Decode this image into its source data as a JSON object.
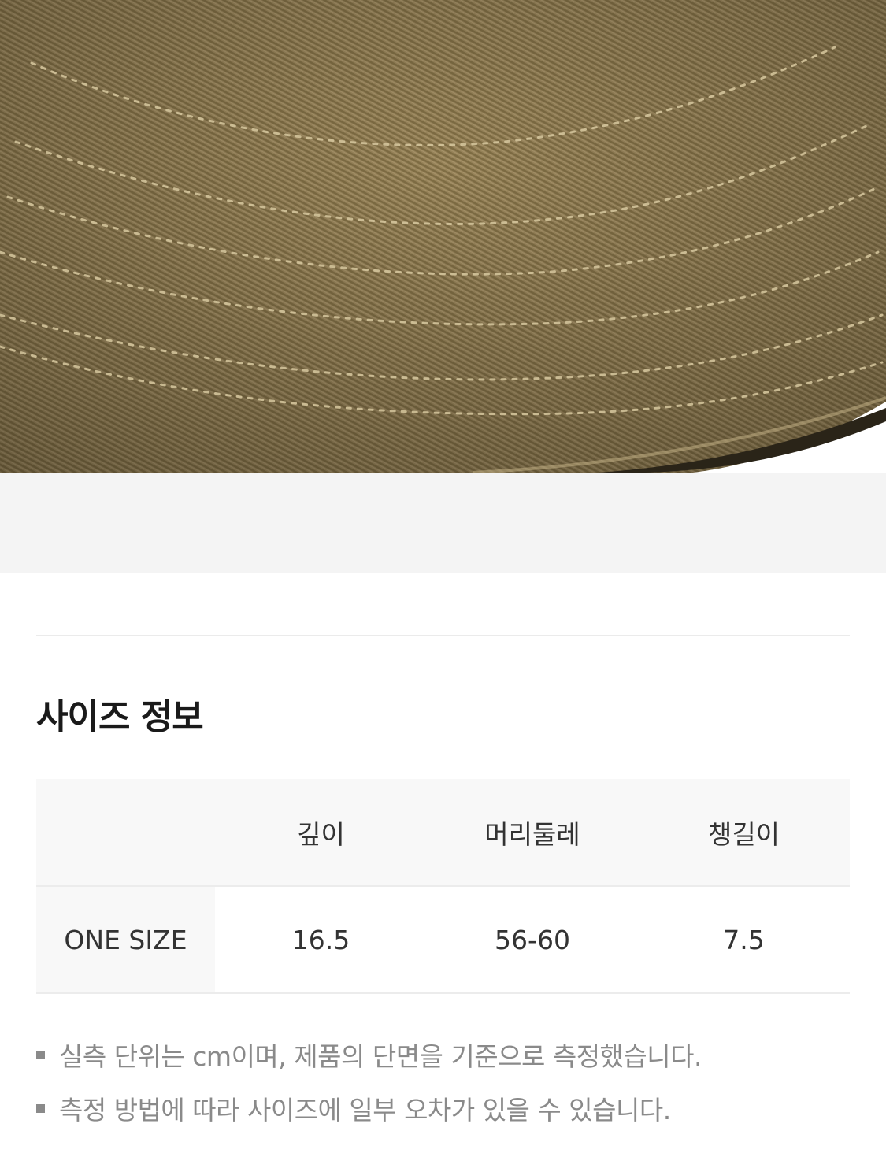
{
  "product_image": {
    "description_icon": "cap-brim-photo",
    "fabric_color": "#9a8658"
  },
  "size_section": {
    "title": "사이즈 정보",
    "table": {
      "columns": [
        "",
        "깊이",
        "머리둘레",
        "챙길이"
      ],
      "rows": [
        {
          "label": "ONE SIZE",
          "values": [
            "16.5",
            "56-60",
            "7.5"
          ]
        }
      ]
    },
    "notes": [
      "실측 단위는 cm이며, 제품의 단면을 기준으로 측정했습니다.",
      "측정 방법에 따라 사이즈에 일부 오차가 있을 수 있습니다."
    ]
  }
}
